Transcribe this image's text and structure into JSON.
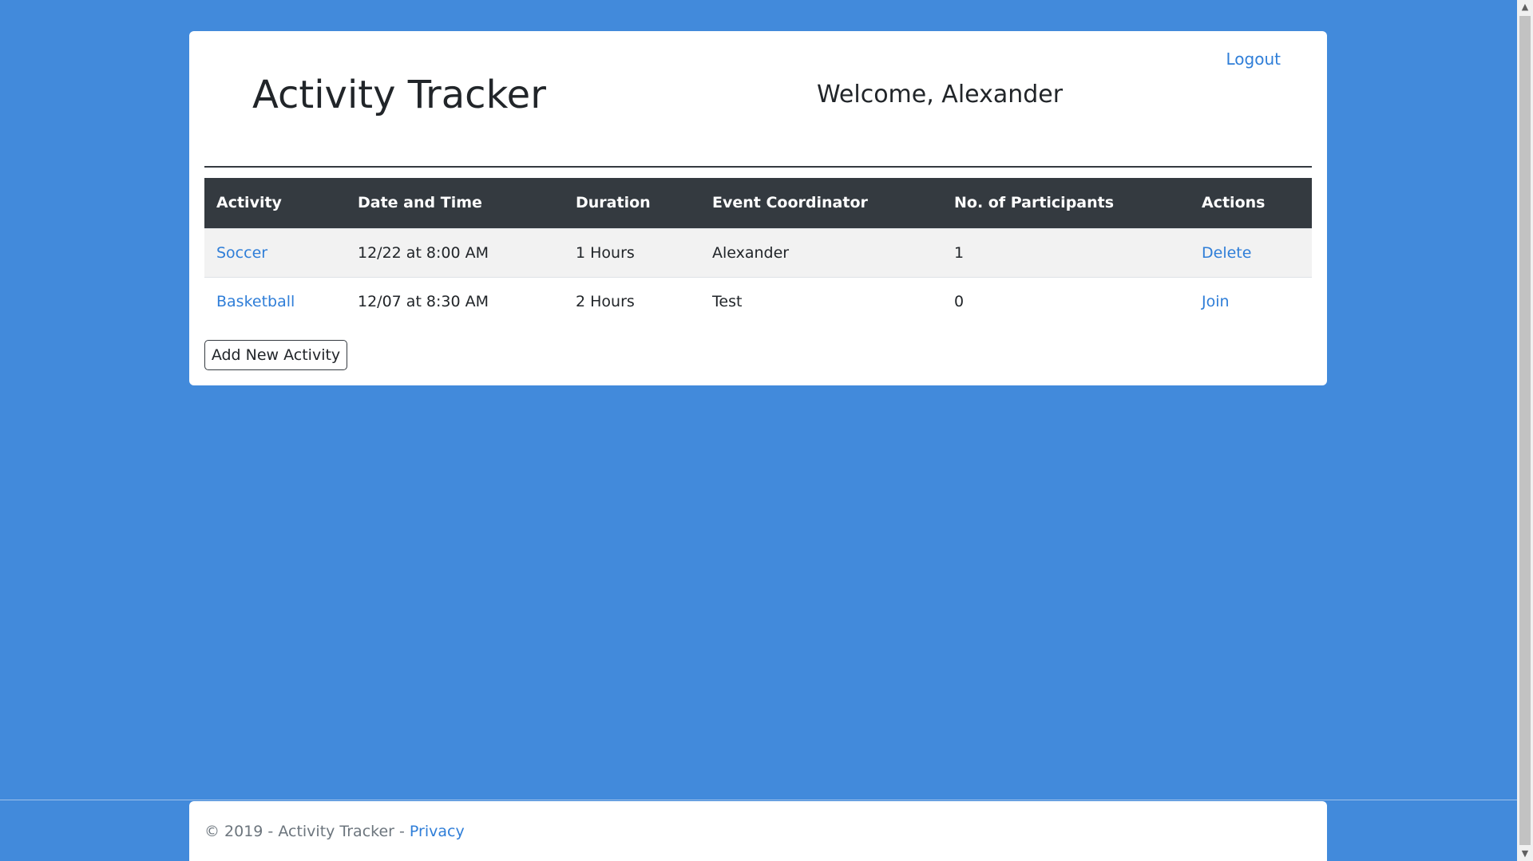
{
  "header": {
    "app_title": "Activity Tracker",
    "welcome_text": "Welcome, Alexander",
    "logout_label": "Logout"
  },
  "table": {
    "columns": [
      "Activity",
      "Date and Time",
      "Duration",
      "Event Coordinator",
      "No. of Participants",
      "Actions"
    ],
    "rows": [
      {
        "activity": "Soccer",
        "datetime": "12/22 at 8:00 AM",
        "duration": "1 Hours",
        "coordinator": "Alexander",
        "participants": "1",
        "action": "Delete"
      },
      {
        "activity": "Basketball",
        "datetime": "12/07 at 8:30 AM",
        "duration": "2 Hours",
        "coordinator": "Test",
        "participants": "0",
        "action": "Join"
      }
    ]
  },
  "add_button_label": "Add New Activity",
  "footer": {
    "copyright": "© 2019 - Activity Tracker - ",
    "privacy_label": "Privacy"
  },
  "colors": {
    "background": "#428adb",
    "link": "#2f7ed8",
    "table_header": "#343a40"
  },
  "icons": {
    "scroll_up": "scroll-up-arrow-icon",
    "scroll_down": "scroll-down-arrow-icon"
  }
}
